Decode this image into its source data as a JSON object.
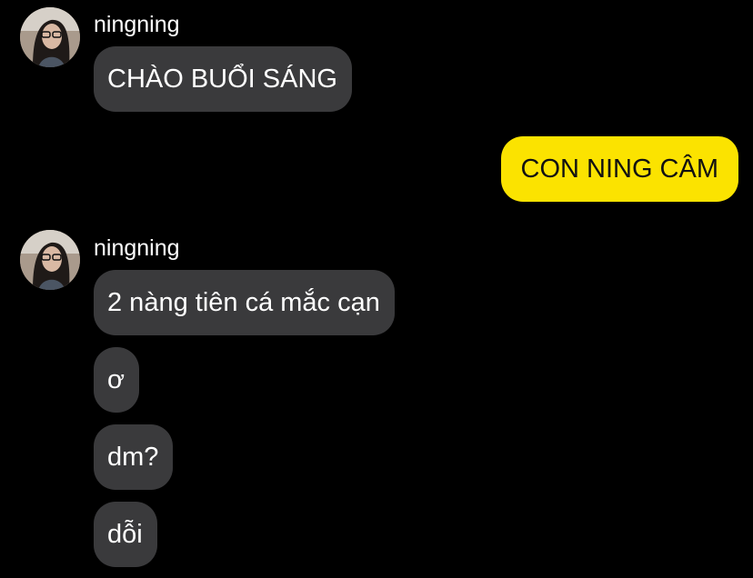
{
  "conversation": {
    "groups": [
      {
        "sender": "ningning",
        "messages": [
          "CHÀO BUỔI SÁNG"
        ]
      },
      {
        "sender": "me",
        "messages": [
          "CON NING CÂM"
        ]
      },
      {
        "sender": "ningning",
        "messages": [
          "2 nàng tiên cá mắc cạn",
          "ơ",
          "dm?",
          "dỗi"
        ]
      }
    ]
  },
  "colors": {
    "background": "#000000",
    "incoming_bubble": "#3a3a3c",
    "outgoing_bubble": "#fbe300"
  }
}
